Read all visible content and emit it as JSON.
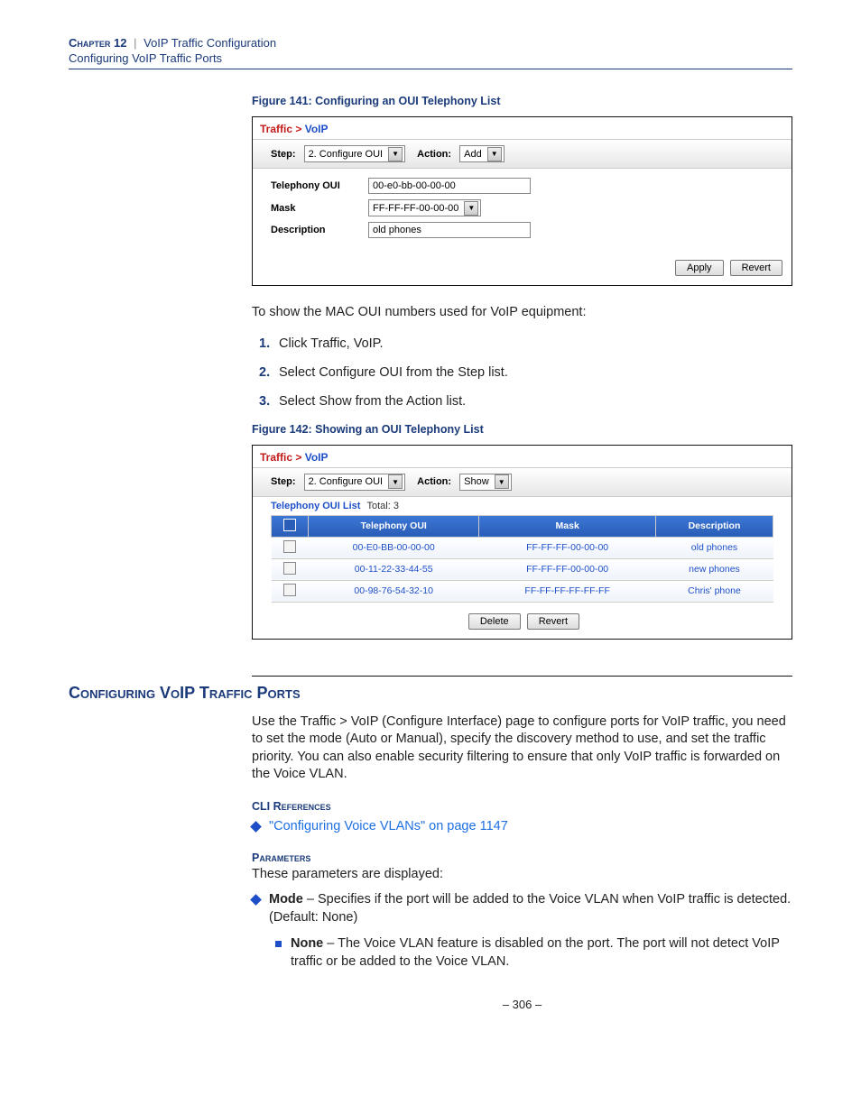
{
  "header": {
    "chapter": "Chapter 12",
    "sep": "|",
    "chapter_title": "VoIP Traffic Configuration",
    "subtitle": "Configuring VoIP Traffic Ports"
  },
  "fig141": {
    "caption": "Figure 141:  Configuring an OUI Telephony List",
    "breadcrumb": {
      "a": "Traffic",
      "gt": ">",
      "b": "VoIP"
    },
    "step_label": "Step:",
    "step_value": "2. Configure OUI",
    "action_label": "Action:",
    "action_value": "Add",
    "row1_label": "Telephony OUI",
    "row1_value": "00-e0-bb-00-00-00",
    "row2_label": "Mask",
    "row2_value": "FF-FF-FF-00-00-00",
    "row3_label": "Description",
    "row3_value": "old phones",
    "apply": "Apply",
    "revert": "Revert"
  },
  "between141_142": {
    "intro": "To show the MAC OUI numbers used for VoIP equipment:",
    "step1": "Click Traffic, VoIP.",
    "step2": "Select Configure OUI from the Step list.",
    "step3": "Select Show from the Action list."
  },
  "fig142": {
    "caption": "Figure 142:  Showing an OUI Telephony List",
    "breadcrumb": {
      "a": "Traffic",
      "gt": ">",
      "b": "VoIP"
    },
    "step_label": "Step:",
    "step_value": "2. Configure OUI",
    "action_label": "Action:",
    "action_value": "Show",
    "list_title": "Telephony OUI List",
    "total_label": "Total: 3",
    "th_oui": "Telephony OUI",
    "th_mask": "Mask",
    "th_desc": "Description",
    "rows": [
      {
        "oui": "00-E0-BB-00-00-00",
        "mask": "FF-FF-FF-00-00-00",
        "desc": "old phones"
      },
      {
        "oui": "00-11-22-33-44-55",
        "mask": "FF-FF-FF-00-00-00",
        "desc": "new phones"
      },
      {
        "oui": "00-98-76-54-32-10",
        "mask": "FF-FF-FF-FF-FF-FF",
        "desc": "Chris' phone"
      }
    ],
    "delete": "Delete",
    "revert": "Revert"
  },
  "section": {
    "title": "Configuring VoIP Traffic Ports",
    "intro": "Use the Traffic > VoIP (Configure Interface) page to configure ports for VoIP traffic, you need to set the mode (Auto or Manual), specify the discovery method to use, and set the traffic priority. You can also enable security filtering to ensure that only VoIP traffic is forwarded on the Voice VLAN.",
    "cli_head": "CLI References",
    "cli_link": "\"Configuring Voice VLANs\" on page 1147",
    "params_head": "Parameters",
    "params_intro": "These parameters are displayed:",
    "mode_bold": "Mode",
    "mode_text": " – Specifies if the port will be added to the Voice VLAN when VoIP traffic is detected. (Default: None)",
    "none_bold": "None",
    "none_text": " – The Voice VLAN feature is disabled on the port. The port will not detect VoIP traffic or be added to the Voice VLAN."
  },
  "footer": {
    "page": "–  306  –"
  }
}
